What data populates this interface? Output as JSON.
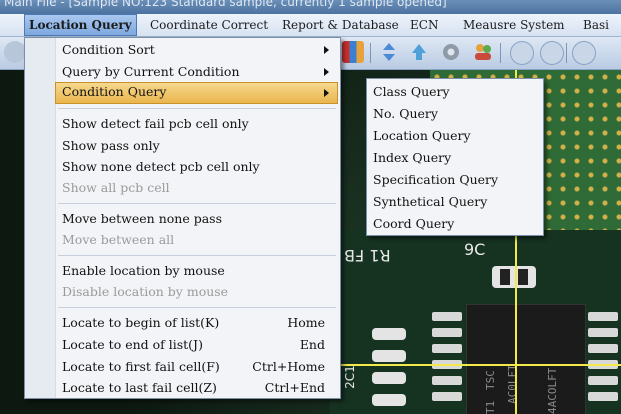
{
  "window": {
    "title": "Main File - [Sample NO:123 Standard sample, currently 1 sample opened]"
  },
  "menubar": {
    "items": [
      {
        "label": "Location Query",
        "active": true
      },
      {
        "label": "Coordinate Correct"
      },
      {
        "label": "Report & Database"
      },
      {
        "label": "ECN"
      },
      {
        "label": "Meausre System"
      },
      {
        "label": "Basi"
      }
    ]
  },
  "dropdown": {
    "items": [
      {
        "label": "Condition Sort",
        "submenu": true
      },
      {
        "label": "Query by Current Condition",
        "submenu": true
      },
      {
        "label": "Condition Query",
        "submenu": true,
        "highlighted": true
      },
      {
        "label": "Show detect fail pcb cell only"
      },
      {
        "label": "Show pass only"
      },
      {
        "label": "Show none detect pcb cell only"
      },
      {
        "label": "Show all pcb cell",
        "disabled": true
      },
      {
        "label": "Move between none pass"
      },
      {
        "label": "Move between all",
        "disabled": true
      },
      {
        "label": "Enable location by mouse"
      },
      {
        "label": "Disable location by mouse",
        "disabled": true
      },
      {
        "label": "Locate to begin of list(K)",
        "shortcut": "Home"
      },
      {
        "label": "Locate to end of list(J)",
        "shortcut": "End"
      },
      {
        "label": "Locate to first fail cell(F)",
        "shortcut": "Ctrl+Home"
      },
      {
        "label": "Locate to last fail cell(Z)",
        "shortcut": "Ctrl+End"
      }
    ]
  },
  "submenu": {
    "items": [
      {
        "label": "Class Query"
      },
      {
        "label": "No. Query"
      },
      {
        "label": "Location Query"
      },
      {
        "label": "Index Query"
      },
      {
        "label": "Specification Query"
      },
      {
        "label": "Synthetical Query"
      },
      {
        "label": "Coord Query"
      }
    ]
  },
  "pcb": {
    "silkscreen": [
      "R1 FB",
      "9C",
      "TSC",
      "AC0LFT",
      "T1",
      "4ACOLFT",
      "2C1"
    ]
  },
  "colors": {
    "highlight": "#eab64f",
    "menubar_active": "#7ea8df",
    "crosshair": "#f2e94a"
  },
  "icons": [
    "chart-icon",
    "up-down-arrows-icon",
    "up-arrow-icon",
    "gear-icon",
    "users-icon",
    "loop-icon",
    "pause-icon"
  ]
}
